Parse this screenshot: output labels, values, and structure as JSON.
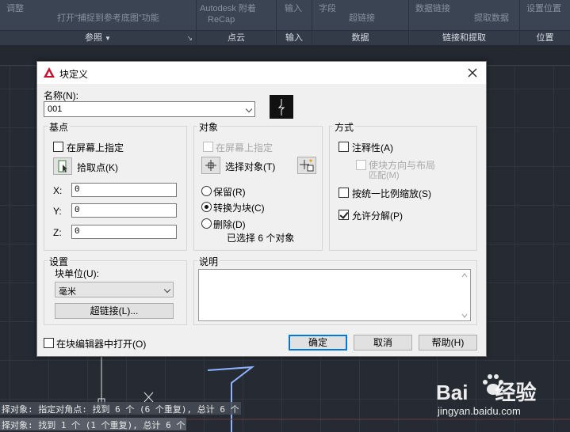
{
  "ribbon": {
    "panels": [
      {
        "title": "参照",
        "lines": [
          "调整",
          "打开\"捕捉到参考底图\"功能"
        ]
      },
      {
        "title": "点云",
        "lines": [
          "Autodesk 附着",
          "ReCap"
        ]
      },
      {
        "title": "输入",
        "lines": [
          "输入"
        ]
      },
      {
        "title": "数据",
        "lines": [
          "字段",
          "超链接"
        ]
      },
      {
        "title": "链接和提取",
        "lines": [
          "数据链接",
          "提取数据"
        ]
      },
      {
        "title": "位置",
        "lines": [
          "设置位置"
        ]
      }
    ]
  },
  "dialog": {
    "title": "块定义",
    "name_label": "名称(N):",
    "name_value": "001",
    "basepoint": {
      "title": "基点",
      "specify_onscreen": "在屏幕上指定",
      "pick_point": "拾取点(K)",
      "x_label": "X:",
      "x_value": "0",
      "y_label": "Y:",
      "y_value": "0",
      "z_label": "Z:",
      "z_value": "0"
    },
    "objects": {
      "title": "对象",
      "specify_onscreen": "在屏幕上指定",
      "select_objects": "选择对象(T)",
      "retain": "保留(R)",
      "convert": "转换为块(C)",
      "delete": "删除(D)",
      "selected_count": "已选择 6 个对象"
    },
    "behavior": {
      "title": "方式",
      "annotative": "注释性(A)",
      "match_orientation_1": "使块方向与布局",
      "match_orientation_2": "匹配(M)",
      "scale_uniformly": "按统一比例缩放(S)",
      "allow_exploding": "允许分解(P)",
      "annotative_checked": false,
      "scale_uniformly_checked": false,
      "allow_exploding_checked": true
    },
    "settings": {
      "title": "设置",
      "unit_label": "块单位(U):",
      "unit_value": "毫米",
      "hyperlink": "超链接(L)..."
    },
    "description": {
      "title": "说明",
      "value": ""
    },
    "open_in_editor": "在块编辑器中打开(O)",
    "ok": "确定",
    "cancel": "取消",
    "help": "帮助(H)"
  },
  "command_lines": [
    "择对象: 指定对角点: 找到 6 个 (6 个重复), 总计 6 个",
    "择对象: 找到 1 个 (1 个重复), 总计 6 个"
  ],
  "watermark": {
    "logo": "Bai 经验",
    "url": "jingyan.baidu.com"
  },
  "colors": {
    "accent": "#0078d7",
    "ribbon_bg": "#3b4453",
    "drawing_bg": "#262b33",
    "polyline": "#8fb3ff"
  }
}
